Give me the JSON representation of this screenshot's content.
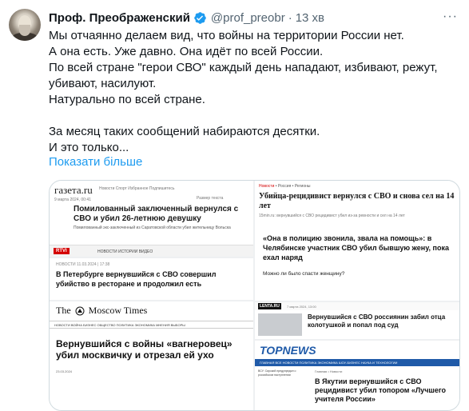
{
  "tweet": {
    "author_name": "Проф. Преображенский",
    "handle": "@prof_preobr",
    "separator": "·",
    "time": "13 хв",
    "more_icon": "more-icon",
    "lines": [
      "Мы отчаянно делаем вид, что войны на территории России нет.",
      "А она есть. Уже давно. Она идёт по всей России.",
      "По всей стране \"герои СВО\" каждый день нападают, избивают, режут,",
      "убивают, насилуют.",
      "Натурально по всей стране.",
      "",
      "За месяц таких сообщений набираются десятки.",
      "И это только..."
    ],
    "show_more": "Показати більше",
    "colors": {
      "link": "#1d9bf0",
      "verified": "#1d9bf0",
      "muted": "#536471"
    }
  },
  "media": {
    "gazeta": {
      "logo": "газета.ru",
      "nav": "Новости   Спорт   Избранное   Подпишитесь",
      "meta": "9 марта 2024, 00:41",
      "font_size_label": "Размер текста",
      "headline": "Помилованный заключенный вернулся с СВО и убил 26-летнюю девушку",
      "subtitle": "Помилованный экс-заключенный из Саратовской области убил жительницу Вольска"
    },
    "rtvi_bar": {
      "logo": "RTVI",
      "nav": "НОВОСТИ     ИСТОРИИ     ВИДЕО"
    },
    "rtvi": {
      "meta": "НОВОСТИ   11.03.2024 | 17:38",
      "headline": "В Петербурге вернувшийся с СВО совершил убийство в ресторане и продолжил есть"
    },
    "moscow_times": {
      "logo_left": "The",
      "logo_right": "Moscow Times",
      "nav": "НОВОСТИ   ВОЙНА   БИЗНЕС   ОБЩЕСТВО   ПОЛИТИКА   ЭКОНОМИКА   МНЕНИЯ   ВЫБОРЫ",
      "headline": "Вернувшийся с войны «вагнеровец» убил москвичку и отрезал ей ухо",
      "date": "23.03.2024"
    },
    "fifteen_min": {
      "crumb_lead": "Новости",
      "crumb_rest": " • Россия • Регионы",
      "headline": "Убийца-рецидивист вернулся с СВО и снова сел на 14 лет",
      "source": "15min.ru: вернувшийся с СВО рецидивист убил из-за ревности и сел на 14 лет",
      "quote": "«Она в полицию звонила, звала на помощь»: в Челябинске участник СВО убил бывшую жену, пока ехал наряд",
      "question": "Можно ли было спасти женщину?"
    },
    "lenta": {
      "logo": "LENTA.RU",
      "meta": "7 марта 2024, 13:00",
      "headline": "Вернувшийся с СВО россиянин забил отца колотушкой и попал под суд"
    },
    "topnews": {
      "logo": "TOPNEWS",
      "nav": "ГЛАВНАЯ   ВСЕ НОВОСТИ   ПОЛИТИКА   ЭКОНОМИКА   ШОУ-БИЗНЕС   НАУКА И ТЕХНОЛОГИИ",
      "left_text": "ВСУ: Сирский предупредил о российском наступлении",
      "crumb": "Главная • Новости",
      "headline": "В Якутии вернувшийся с СВО рецидивист убил топором «Лучшего учителя России»"
    }
  }
}
